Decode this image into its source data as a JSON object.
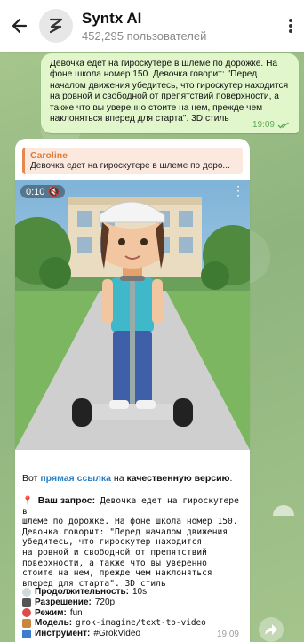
{
  "header": {
    "title": "Syntx AI",
    "subtitle": "452,295 пользователей",
    "back_icon": "arrow-left-icon",
    "menu_icon": "vertical-dots-icon"
  },
  "outgoing": {
    "text": "Девочка едет на гироскутере в шлеме по дорожке. На фоне школа номер 150. Девочка говорит: \"Перед началом движения убедитесь, что гироскутер находится на ровной и свободной от препятствий поверхности, а также что вы уверенно стоите на нем, прежде чем наклоняться вперед для старта\". 3D стиль",
    "time": "19:09"
  },
  "incoming": {
    "reply_name": "Caroline",
    "reply_text": "Девочка едет на гироскутере в шлеме по доро...",
    "video_time": "0:10",
    "link_prefix": "Вот ",
    "link_text": "прямая ссылка",
    "link_middle": " на ",
    "link_bold": "качественную версию",
    "link_suffix": ".",
    "request_label": "Ваш запрос:",
    "request_first": "Девочка едет на гироскутере в",
    "request_lines": [
      "шлеме по дорожке. На фоне школа номер 150.",
      "Девочка говорит: \"Перед началом движения",
      "убедитесь, что гироскутер находится",
      "на ровной и свободной от препятствий",
      "поверхности, а также что вы уверенно",
      "стоите на нем, прежде чем наклоняться",
      "вперед для старта\". 3D стиль"
    ],
    "details": [
      {
        "label": "Продолжительность:",
        "value": "10s",
        "icon": "stopwatch-icon",
        "mono": false
      },
      {
        "label": "Разрешение:",
        "value": "720p",
        "icon": "camera-icon",
        "mono": false
      },
      {
        "label": "Режим:",
        "value": "fun",
        "icon": "target-icon",
        "mono": false
      },
      {
        "label": "Модель:",
        "value": "grok-imagine/text-to-video",
        "icon": "box-icon",
        "mono": true
      },
      {
        "label": "Инструмент:",
        "value": "#GrokVideo",
        "icon": "grid-icon",
        "mono": false
      }
    ],
    "time": "19:09"
  },
  "colors": {
    "accent": "#2a7ec2",
    "outgoing_bg": "#e1f7cb",
    "reply_accent": "#e07a3a",
    "check": "#5ca856"
  }
}
